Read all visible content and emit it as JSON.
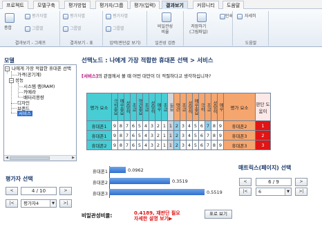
{
  "tabs": [
    "프로젝트",
    "모델구축",
    "평가방법",
    "평가자/그룹",
    "평가(입력)",
    "결과보기",
    "커뮤니티",
    "도움말"
  ],
  "ribbon": {
    "b1": "종합",
    "b2": "평가자별",
    "b3": "그룹별",
    "b4": "평가자별",
    "b5": "그룹별",
    "b6": "평가자별",
    "b7": "그룹별",
    "b8": "비일관성\n비율",
    "b9": "저장하기\n(그림파일)",
    "b10": "인쇄",
    "b11": "자세히",
    "g1": "결과보기 - 그래프",
    "g2": "결과보기 - 표",
    "g3": "입력(판단값 보기)",
    "g4": "일관성 검증",
    "g5": "",
    "g6": "도움말"
  },
  "left": {
    "model_title": "모델",
    "tree": [
      "나에게 가장 적합한 휴대폰 선택",
      "가격(공기계)",
      "성능",
      "시스템 램(RAM)",
      "카메라",
      "배터리용량",
      "디자인",
      "브랜드",
      "서비스"
    ],
    "evaluator_title": "평가자 선택",
    "page": "4 / 10",
    "evaluator_value": "평가자4"
  },
  "main": {
    "node_title": "선택노드 : 나에게 가장 적합한 휴대폰 선택 > 서비스",
    "question_hl": "[서비스]",
    "question_rest": "의 관점에서 볼 때 어떤 대안이 더 적절하다고 생각하십니까?",
    "matrix": {
      "left_header": "평가 요소",
      "right_header": "평가 요소",
      "last_header": "판단 도움이",
      "scale_left": [
        "극히중요",
        "매우중요",
        "상당히",
        "조금",
        "약간중요",
        "조금",
        "상당히",
        "매우",
        "조금"
      ],
      "scale_mid": "동등",
      "scale_right": [
        "약간",
        "조금",
        "상당히",
        "매우중요",
        "극히",
        "조금",
        "상당히",
        "매우",
        "극히중요"
      ],
      "rows": [
        {
          "left": "휴대폰1",
          "vals_l": [
            "9",
            "8",
            "7",
            "6",
            "5",
            "4",
            "3",
            "2",
            "1"
          ],
          "vals_r": [
            "2",
            "3",
            "4",
            "5",
            "6",
            "7",
            "8",
            "9"
          ],
          "right": "휴대폰2",
          "flag": "1",
          "sel": 6
        },
        {
          "left": "휴대폰1",
          "vals_l": [
            "9",
            "8",
            "7",
            "6",
            "5",
            "4",
            "3",
            "2",
            "1"
          ],
          "vals_r": [
            "2",
            "3",
            "4",
            "5",
            "6",
            "7",
            "8",
            "9"
          ],
          "right": "휴대폰3",
          "flag": "2",
          "sel": 0
        },
        {
          "left": "휴대폰2",
          "vals_l": [
            "9",
            "8",
            "7",
            "6",
            "5",
            "4",
            "3",
            "2",
            "1"
          ],
          "vals_r": [
            "2",
            "3",
            "4",
            "5",
            "6",
            "7",
            "8",
            "9"
          ],
          "right": "휴대폰3",
          "flag": "3",
          "sel": 0
        }
      ]
    }
  },
  "chart_data": {
    "type": "bar",
    "orientation": "horizontal",
    "categories": [
      "휴대폰1",
      "휴대폰2",
      "휴대폰3"
    ],
    "values": [
      0.0962,
      0.3519,
      0.5519
    ],
    "value_labels": [
      "0.0962",
      "0.3519",
      "0.5519"
    ]
  },
  "consistency": {
    "label": "비일관성비율:",
    "text1": "0.4189, 재판단 필요",
    "text2": "자세한 설명 보기▶",
    "button": "표로 보기"
  },
  "matrix_page": {
    "title": "매트릭스(페이지) 선택",
    "page": "6 / 9",
    "select": "6"
  },
  "colors": {
    "teal": "#48cdd4",
    "orange": "#f5a66e",
    "red": "#e01515",
    "bar": "#2f6fcf"
  }
}
